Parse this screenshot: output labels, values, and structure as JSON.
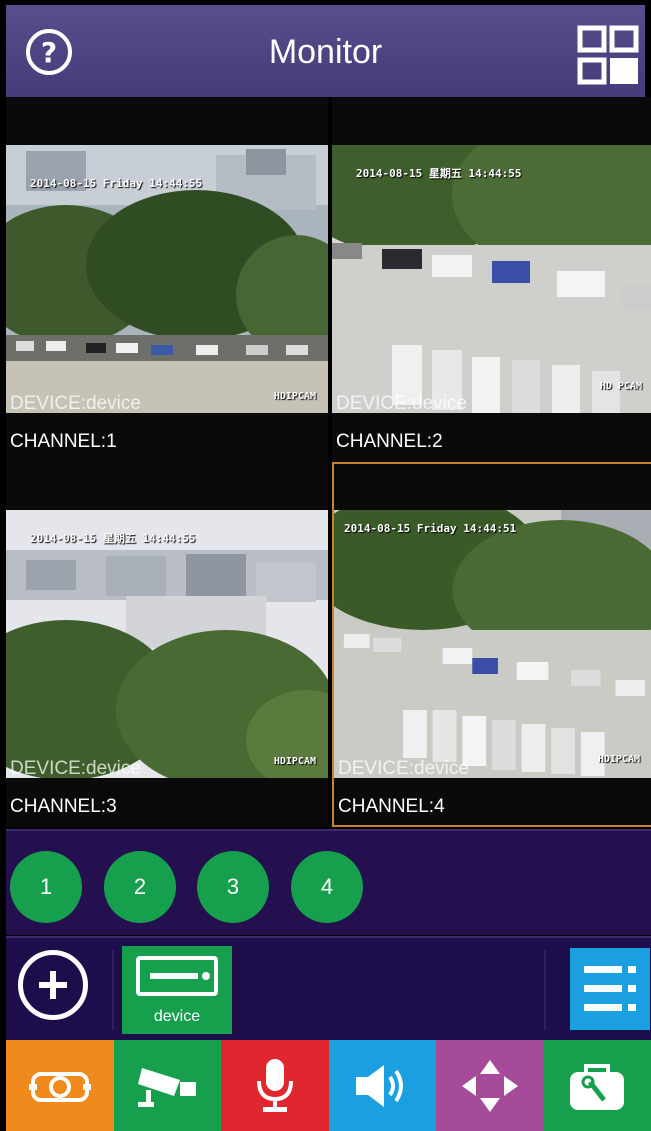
{
  "header": {
    "title": "Monitor",
    "help_icon": "help-circle-icon",
    "layout_icon": "grid-layout-icon"
  },
  "channels": [
    {
      "device": "DEVICE:device",
      "channel": "CHANNEL:1",
      "stamp": "2014-08-15 Friday 14:44:55",
      "logo": "HDIPCAM",
      "selected": false
    },
    {
      "device": "DEVICE:device",
      "channel": "CHANNEL:2",
      "stamp": "2014-08-15 星期五 14:44:55",
      "logo": "HD PCAM",
      "selected": false
    },
    {
      "device": "DEVICE:device",
      "channel": "CHANNEL:3",
      "stamp": "2014-08-15 星期五 14:44:55",
      "logo": "HDIPCAM",
      "selected": false
    },
    {
      "device": "DEVICE:device",
      "channel": "CHANNEL:4",
      "stamp": "2014-08-15 Friday 14:44:51",
      "logo": "HDIPCAM",
      "selected": true
    }
  ],
  "channel_buttons": [
    "1",
    "2",
    "3",
    "4"
  ],
  "device_bar": {
    "add_icon": "add-circle-icon",
    "device_name": "device",
    "device_icon": "dvr-icon",
    "menu_icon": "list-menu-icon"
  },
  "toolbar": [
    {
      "icon": "snapshot-icon",
      "color": "#f08a1c"
    },
    {
      "icon": "record-camera-icon",
      "color": "#16a04d"
    },
    {
      "icon": "microphone-icon",
      "color": "#e0262e"
    },
    {
      "icon": "speaker-icon",
      "color": "#1aa0e0"
    },
    {
      "icon": "ptz-arrows-icon",
      "color": "#a64a9a"
    },
    {
      "icon": "toolbox-icon",
      "color": "#16a04d"
    }
  ]
}
